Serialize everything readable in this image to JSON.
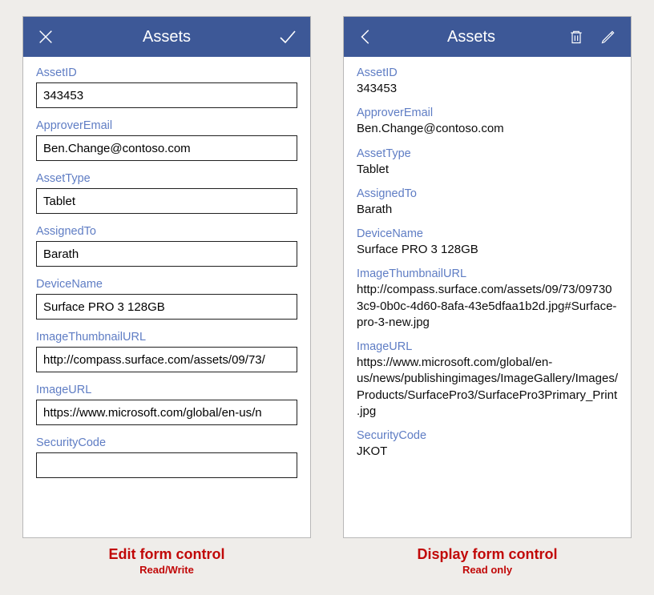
{
  "edit": {
    "title": "Assets",
    "fields": {
      "assetId": {
        "label": "AssetID",
        "value": "343453"
      },
      "approverEmail": {
        "label": "ApproverEmail",
        "value": "Ben.Change@contoso.com"
      },
      "assetType": {
        "label": "AssetType",
        "value": "Tablet"
      },
      "assignedTo": {
        "label": "AssignedTo",
        "value": "Barath"
      },
      "deviceName": {
        "label": "DeviceName",
        "value": "Surface PRO 3 128GB"
      },
      "imageThumb": {
        "label": "ImageThumbnailURL",
        "value": "http://compass.surface.com/assets/09/73/"
      },
      "imageUrl": {
        "label": "ImageURL",
        "value": "https://www.microsoft.com/global/en-us/n"
      },
      "securityCode": {
        "label": "SecurityCode"
      }
    },
    "caption": {
      "title": "Edit form control",
      "sub": "Read/Write"
    }
  },
  "display": {
    "title": "Assets",
    "fields": {
      "assetId": {
        "label": "AssetID",
        "value": "343453"
      },
      "approverEmail": {
        "label": "ApproverEmail",
        "value": "Ben.Change@contoso.com"
      },
      "assetType": {
        "label": "AssetType",
        "value": "Tablet"
      },
      "assignedTo": {
        "label": "AssignedTo",
        "value": "Barath"
      },
      "deviceName": {
        "label": "DeviceName",
        "value": "Surface PRO 3 128GB"
      },
      "imageThumb": {
        "label": "ImageThumbnailURL",
        "value": "http://compass.surface.com/assets/09/73/097303c9-0b0c-4d60-8afa-43e5dfaa1b2d.jpg#Surface-pro-3-new.jpg"
      },
      "imageUrl": {
        "label": "ImageURL",
        "value": "https://www.microsoft.com/global/en-us/news/publishingimages/ImageGallery/Images/Products/SurfacePro3/SurfacePro3Primary_Print.jpg"
      },
      "securityCode": {
        "label": "SecurityCode",
        "value": "JKOT"
      }
    },
    "caption": {
      "title": "Display form control",
      "sub": "Read only"
    }
  }
}
